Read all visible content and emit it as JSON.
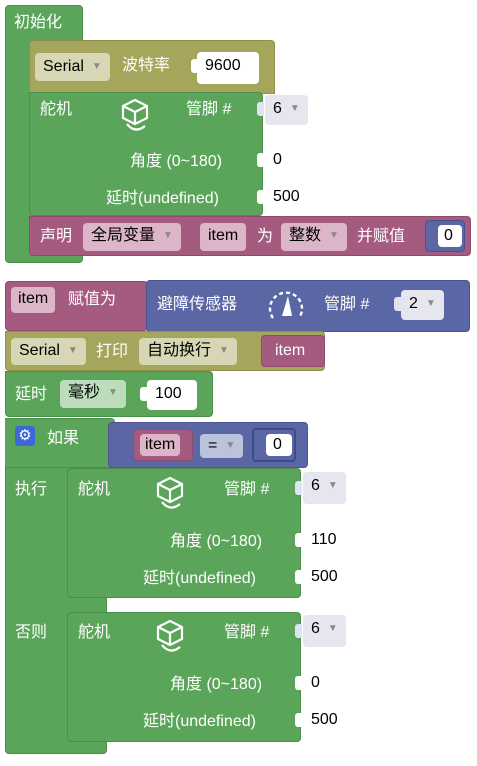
{
  "setup": {
    "title": "初始化",
    "serial": {
      "port": "Serial",
      "baud_label": "波特率",
      "baud": "9600"
    },
    "servo": {
      "label": "舵机",
      "pin_label": "管脚 #",
      "pin": "6",
      "angle_label": "角度 (0~180)",
      "angle": "0",
      "delay_label": "延时(undefined)",
      "delay": "500"
    },
    "declare": {
      "label": "声明",
      "scope": "全局变量",
      "var": "item",
      "as_label": "为",
      "type": "整数",
      "assign_label": "并赋值",
      "value": "0"
    }
  },
  "assign": {
    "var": "item",
    "label": "赋值为",
    "sensor_label": "避障传感器",
    "pin_label": "管脚 #",
    "pin": "2"
  },
  "print": {
    "port": "Serial",
    "label": "打印",
    "mode": "自动换行",
    "var": "item"
  },
  "delay": {
    "label": "延时",
    "unit": "毫秒",
    "value": "100"
  },
  "if_block": {
    "if_label": "如果",
    "var": "item",
    "op": "=",
    "value": "0",
    "do_label": "执行",
    "else_label": "否则",
    "do_servo": {
      "label": "舵机",
      "pin_label": "管脚 #",
      "pin": "6",
      "angle_label": "角度 (0~180)",
      "angle": "110",
      "delay_label": "延时(undefined)",
      "delay": "500"
    },
    "else_servo": {
      "label": "舵机",
      "pin_label": "管脚 #",
      "pin": "6",
      "angle_label": "角度 (0~180)",
      "angle": "0",
      "delay_label": "延时(undefined)",
      "delay": "500"
    }
  },
  "icons": [
    "servo-icon",
    "sensor-icon",
    "gear-icon",
    "dropdown-arrow-icon"
  ]
}
